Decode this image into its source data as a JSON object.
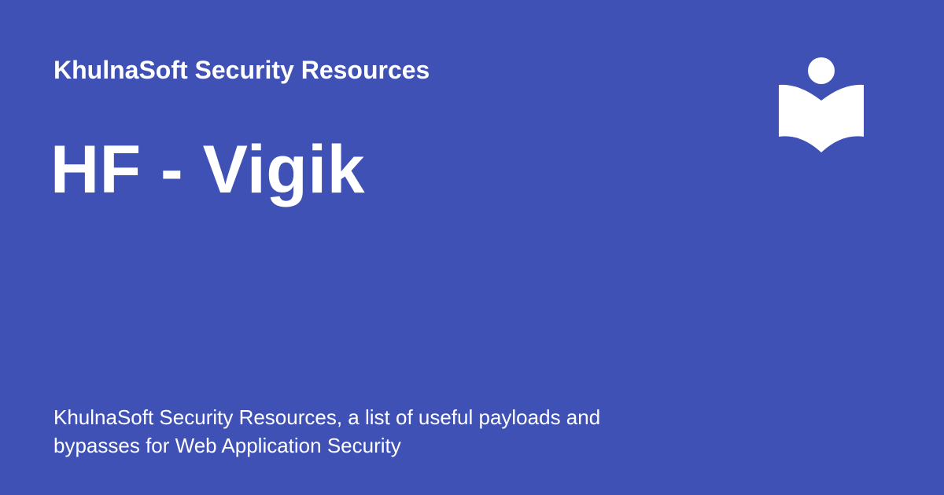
{
  "header": {
    "site_name": "KhulnaSoft Security Resources"
  },
  "main": {
    "title": "HF - Vigik",
    "description": "KhulnaSoft Security Resources, a list of useful payloads and bypasses for Web Application Security"
  },
  "logo": {
    "icon": "reader-book-icon",
    "color": "#ffffff"
  },
  "theme": {
    "background": "#3f51b5",
    "text_color": "#ffffff"
  }
}
